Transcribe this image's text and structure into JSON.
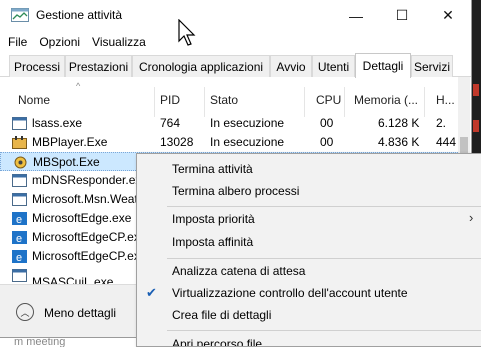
{
  "window": {
    "title": "Gestione attività",
    "controls": {
      "minimize": "—",
      "maximize": "☐",
      "close": "✕"
    }
  },
  "menubar": [
    "File",
    "Opzioni",
    "Visualizza"
  ],
  "tabs": [
    {
      "label": "Processi",
      "active": false
    },
    {
      "label": "Prestazioni",
      "active": false
    },
    {
      "label": "Cronologia applicazioni",
      "active": false
    },
    {
      "label": "Avvio",
      "active": false
    },
    {
      "label": "Utenti",
      "active": false
    },
    {
      "label": "Dettagli",
      "active": true
    },
    {
      "label": "Servizi",
      "active": false
    }
  ],
  "table": {
    "columns": [
      "Nome",
      "PID",
      "Stato",
      "CPU",
      "Memoria (...",
      "H..."
    ],
    "rows": [
      {
        "name": "lsass.exe",
        "pid": "764",
        "status": "In esecuzione",
        "cpu": "00",
        "memory": "6.128 K",
        "h": "2.",
        "icon": "exe-icon",
        "selected": false
      },
      {
        "name": "MBPlayer.Exe",
        "pid": "13028",
        "status": "In esecuzione",
        "cpu": "00",
        "memory": "4.836 K",
        "h": "444",
        "icon": "media-player-icon",
        "selected": false
      },
      {
        "name": "MBSpot.Exe",
        "pid": "",
        "status": "",
        "cpu": "",
        "memory": "",
        "h": "",
        "icon": "mbspot-icon",
        "selected": true
      },
      {
        "name": "mDNSResponder.exe",
        "pid": "",
        "status": "",
        "cpu": "",
        "memory": "",
        "h": "",
        "icon": "exe-icon",
        "selected": false
      },
      {
        "name": "Microsoft.Msn.Weat",
        "pid": "",
        "status": "",
        "cpu": "",
        "memory": "",
        "h": "",
        "icon": "exe-icon",
        "selected": false
      },
      {
        "name": "MicrosoftEdge.exe",
        "pid": "",
        "status": "",
        "cpu": "",
        "memory": "",
        "h": "",
        "icon": "edge-icon",
        "selected": false
      },
      {
        "name": "MicrosoftEdgeCP.exe",
        "pid": "",
        "status": "",
        "cpu": "",
        "memory": "",
        "h": "",
        "icon": "edge-icon",
        "selected": false
      },
      {
        "name": "MicrosoftEdgeCP.exe",
        "pid": "",
        "status": "",
        "cpu": "",
        "memory": "",
        "h": "",
        "icon": "edge-icon",
        "selected": false
      },
      {
        "name": "MSASCuiL.exe",
        "pid": "",
        "status": "",
        "cpu": "",
        "memory": "",
        "h": "",
        "icon": "exe-icon",
        "selected": false
      }
    ]
  },
  "footer": {
    "fewer_details": "Meno dettagli"
  },
  "context_menu": {
    "items": [
      {
        "label": "Termina attività",
        "checked": false,
        "submenu": false
      },
      {
        "label": "Termina albero processi",
        "checked": false,
        "submenu": false
      },
      {
        "label": "Imposta priorità",
        "checked": false,
        "submenu": true
      },
      {
        "label": "Imposta affinità",
        "checked": false,
        "submenu": false
      },
      {
        "label": "Analizza catena di attesa",
        "checked": false,
        "submenu": false
      },
      {
        "label": "Virtualizzazione controllo dell'account utente",
        "checked": true,
        "submenu": false
      },
      {
        "label": "Crea file di dettagli",
        "checked": false,
        "submenu": false
      },
      {
        "label": "Apri percorso file",
        "checked": false,
        "submenu": false
      }
    ]
  },
  "background": {
    "bottom_text": "m meeting"
  },
  "colors": {
    "selection": "#cce8ff",
    "check": "#1a5fb4",
    "edge": "#1e73c8"
  }
}
